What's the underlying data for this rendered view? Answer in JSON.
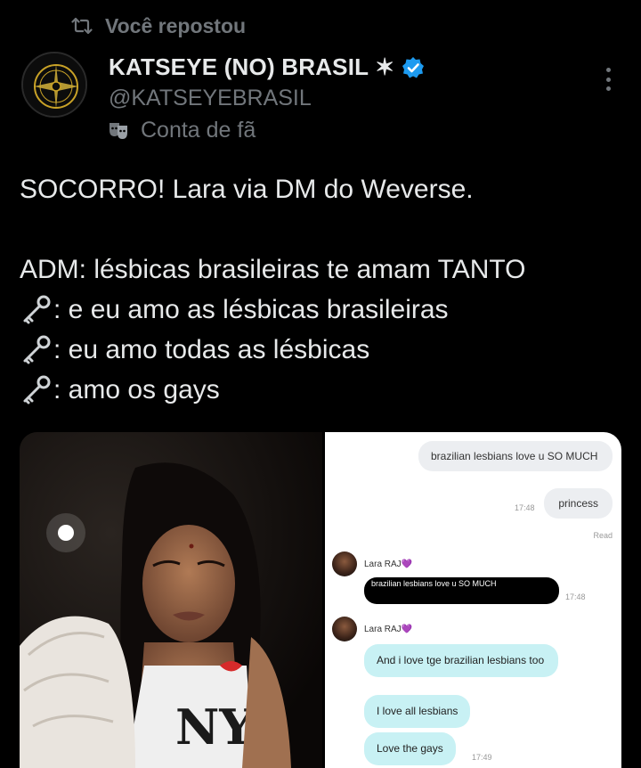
{
  "repost": {
    "label": "Você repostou",
    "icon": "repost-icon"
  },
  "author": {
    "display_name": "KATSEYE (NO) BRASIL",
    "name_symbol": "✶",
    "handle": "@KATSEYEBRASIL",
    "label": "Conta de fã",
    "label_icon": "theater-masks-icon",
    "verified_color": "#1d9bf0"
  },
  "post": {
    "lines": [
      "SOCORRO! Lara via DM do Weverse.",
      "",
      "ADM: lésbicas brasileiras te amam TANTO",
      ": e eu amo as lésbicas brasileiras",
      ": eu amo todas as lésbicas",
      ": amo os gays"
    ],
    "key_icon": "old-key-emoji"
  },
  "chat": {
    "outgoing": [
      {
        "text": "brazilian lesbians love u SO MUCH"
      },
      {
        "text": "princess",
        "time": "17:48"
      }
    ],
    "read_label": "Read",
    "messages": [
      {
        "sender": "Lara RAJ💜",
        "reply_text": "brazilian lesbians love u SO MUCH",
        "time": "17:48"
      },
      {
        "sender": "Lara RAJ💜",
        "bubbles": [
          {
            "text": "And i love tge brazilian lesbians too"
          },
          {
            "text": "I love all lesbians"
          },
          {
            "text": "Love the gays",
            "time": "17:49"
          }
        ]
      }
    ]
  },
  "colors": {
    "background": "#000000",
    "text": "#e7e9ea",
    "muted": "#71767b",
    "incoming_bubble": "#c8f1f4"
  }
}
